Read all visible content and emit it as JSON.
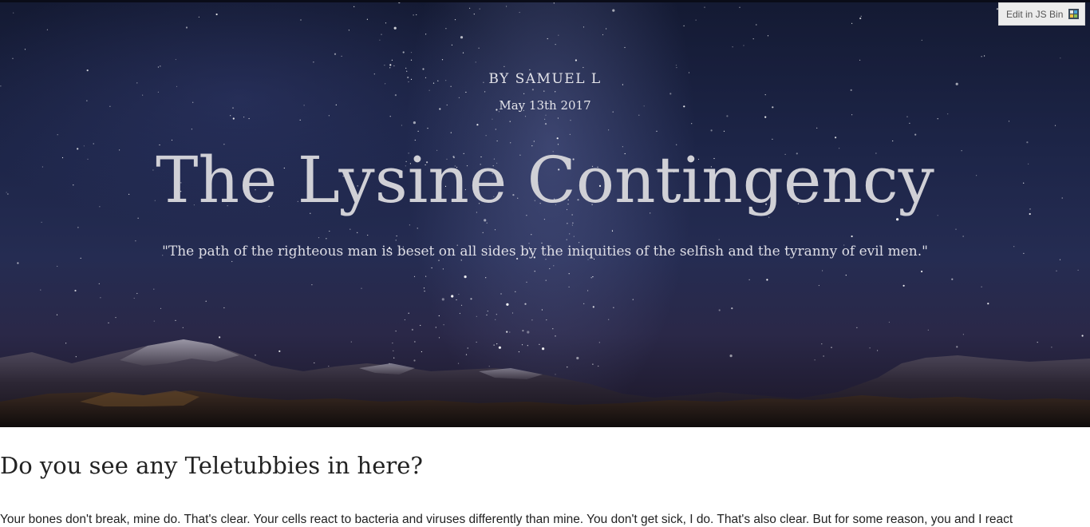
{
  "hero": {
    "byline": "BY SAMUEL L",
    "date": "May 13th 2017",
    "title": "The Lysine Contingency",
    "quote": "\"The path of the righteous man is beset on all sides by the iniquities of the selfish and the tyranny of evil men.\""
  },
  "jsbin": {
    "label": "Edit in JS Bin",
    "icon": "jsbin-icon"
  },
  "article": {
    "heading": "Do you see any Teletubbies in here?",
    "body": "Your bones don't break, mine do. That's clear. Your cells react to bacteria and viruses differently than mine. You don't get sick, I do. That's also clear. But for some reason, you and I react"
  },
  "colors": {
    "sky_top": "#141a33",
    "sky_bottom": "#1b1626",
    "title_text": "#d0d0d6",
    "body_text": "#222222"
  }
}
